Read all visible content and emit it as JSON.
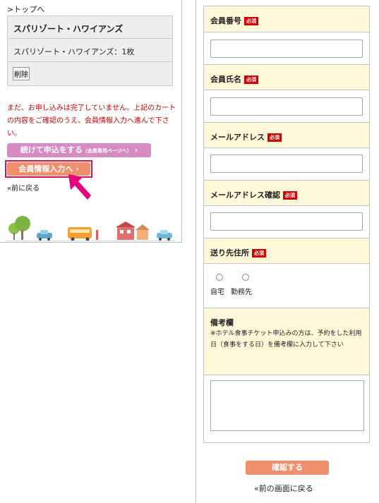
{
  "left": {
    "top_link": ">トップへ",
    "cart_title": "スパリゾート・ハワイアンズ",
    "cart_item": "スパリゾート・ハワイアンズ：1枚",
    "delete_label": "削除",
    "notice": "まだ、お申し込みは完了していません。上記のカートの内容をご確認のうえ、会員情報入力へ進んで下さい。",
    "continue_label": "続けて申込をする",
    "continue_sub": "（会員専用ページへ）",
    "member_label": "会員情報入力へ",
    "back_link": "«前に戻る"
  },
  "form": {
    "required": "必須",
    "member_no_label": "会員番号",
    "member_name_label": "会員氏名",
    "email_label": "メールアドレス",
    "email_confirm_label": "メールアドレス確認",
    "address_label": "送り先住所",
    "address_options": [
      "自宅",
      "勤務先"
    ],
    "remarks_label": "備考欄",
    "remarks_note": "※ホテル食事チケット申込みの方は、予約をした利用日（食事をする日）を備考欄に入力して下さい",
    "confirm_label": "確認する",
    "back_link": "«前の画面に戻る"
  }
}
